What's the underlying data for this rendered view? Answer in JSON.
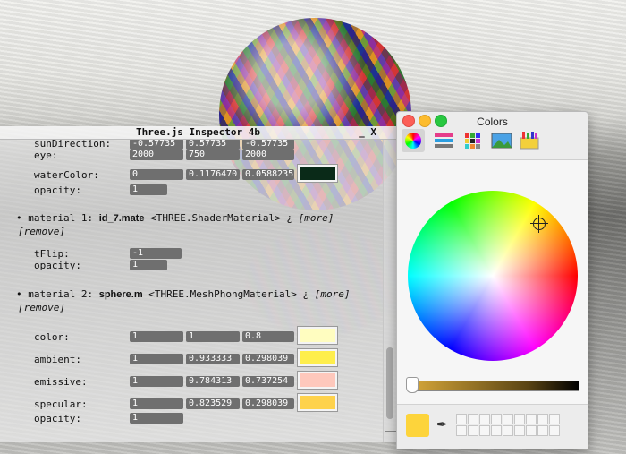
{
  "inspector": {
    "title": "Three.js Inspector 4b",
    "controls": "_ X",
    "rows": [
      {
        "label": "sunDirection:",
        "values": [
          "-0.57735",
          "0.57735",
          "-0.57735"
        ]
      },
      {
        "label": "eye:",
        "values": [
          "2000",
          "750",
          "2000"
        ]
      },
      {
        "label": "waterColor:",
        "values": [
          "0",
          "0.1176470",
          "0.0588235"
        ],
        "swatch": "#0a2a18"
      },
      {
        "label": "opacity:",
        "values": [
          "1"
        ]
      }
    ],
    "material1": {
      "prefix": "• material 1:",
      "name": "id_7.mate",
      "type": "<THREE.ShaderMaterial> ¿",
      "more": "[more]",
      "remove": "[remove]",
      "rows": [
        {
          "label": "tFlip:",
          "values": [
            "-1"
          ]
        },
        {
          "label": "opacity:",
          "values": [
            "1"
          ]
        }
      ]
    },
    "material2": {
      "prefix": "• material 2:",
      "name": "sphere.m",
      "type": "<THREE.MeshPhongMaterial> ¿",
      "more": "[more]",
      "remove": "[remove]",
      "rows": [
        {
          "label": "color:",
          "values": [
            "1",
            "1",
            "0.8"
          ],
          "swatch": "#fffdc0"
        },
        {
          "label": "ambient:",
          "values": [
            "1",
            "0.933333",
            "0.298039"
          ],
          "swatch": "#feee4c"
        },
        {
          "label": "emissive:",
          "values": [
            "1",
            "0.784313",
            "0.737254"
          ],
          "swatch": "#fec8bc"
        },
        {
          "label": "specular:",
          "values": [
            "1",
            "0.823529",
            "0.298039"
          ],
          "swatch": "#fed24c"
        },
        {
          "label": "opacity:",
          "values": [
            "1"
          ]
        }
      ]
    }
  },
  "colors_panel": {
    "title": "Colors",
    "tabs": [
      "color-wheel-icon",
      "color-sliders-icon",
      "color-palettes-icon",
      "image-palettes-icon",
      "crayons-icon"
    ],
    "selected_color": "#fdd43b"
  }
}
